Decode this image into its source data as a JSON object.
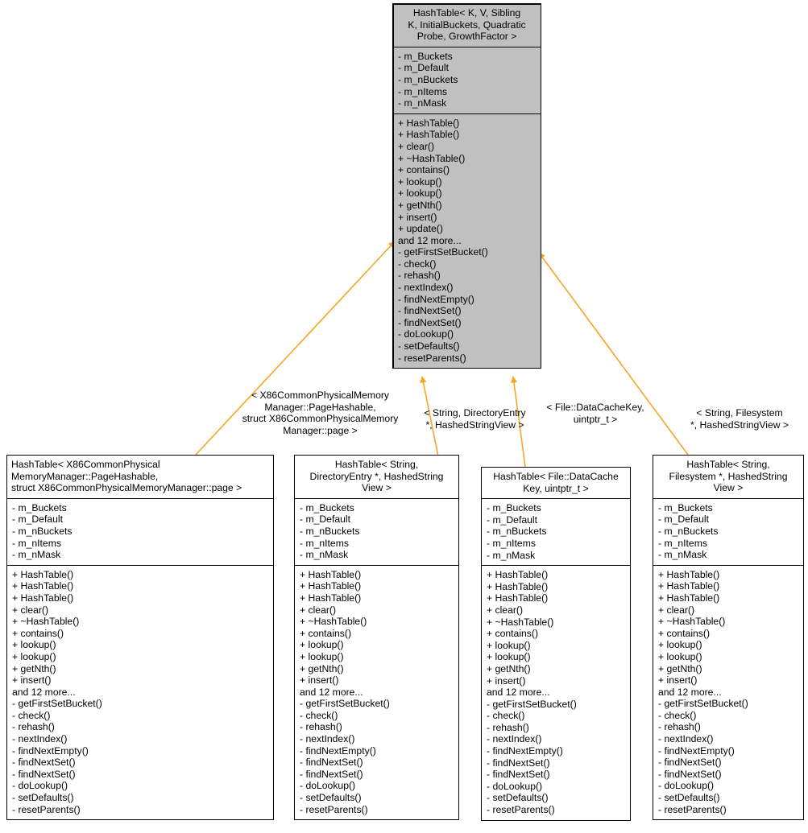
{
  "diagram": {
    "type": "uml-class-inheritance",
    "title": "HashTable template inheritance diagram",
    "colors": {
      "root_fill": "#c0c0c0",
      "child_fill": "#ffffff",
      "border": "#000000",
      "edge": "#f5a623",
      "background": "#ffffff"
    }
  },
  "classes": {
    "root": {
      "name": "HashTable< K, V, Sibling\nK, InitialBuckets, Quadratic\nProbe, GrowthFactor >",
      "attributes": [
        "- m_Buckets",
        "- m_Default",
        "- m_nBuckets",
        "- m_nItems",
        "- m_nMask"
      ],
      "methods": [
        "+ HashTable()",
        "+ HashTable()",
        "+ clear()",
        "+ ~HashTable()",
        "+ contains()",
        "+ lookup()",
        "+ lookup()",
        "+ getNth()",
        "+ insert()",
        "+ update()",
        "and 12 more...",
        "- getFirstSetBucket()",
        "- check()",
        "- rehash()",
        "- nextIndex()",
        "- findNextEmpty()",
        "- findNextSet()",
        "- findNextSet()",
        "- doLookup()",
        "- setDefaults()",
        "- resetParents()"
      ]
    },
    "child1": {
      "name": "HashTable< X86CommonPhysical\nMemoryManager::PageHashable,\n struct X86CommonPhysicalMemoryManager::page >",
      "attributes": [
        "- m_Buckets",
        "- m_Default",
        "- m_nBuckets",
        "- m_nItems",
        "- m_nMask"
      ],
      "methods": [
        "+ HashTable()",
        "+ HashTable()",
        "+ HashTable()",
        "+ clear()",
        "+ ~HashTable()",
        "+ contains()",
        "+ lookup()",
        "+ lookup()",
        "+ getNth()",
        "+ insert()",
        "and 12 more...",
        "- getFirstSetBucket()",
        "- check()",
        "- rehash()",
        "- nextIndex()",
        "- findNextEmpty()",
        "- findNextSet()",
        "- findNextSet()",
        "- doLookup()",
        "- setDefaults()",
        "- resetParents()"
      ]
    },
    "child2": {
      "name": "HashTable< String,\n DirectoryEntry *, HashedString\nView >",
      "attributes": [
        "- m_Buckets",
        "- m_Default",
        "- m_nBuckets",
        "- m_nItems",
        "- m_nMask"
      ],
      "methods": [
        "+ HashTable()",
        "+ HashTable()",
        "+ HashTable()",
        "+ clear()",
        "+ ~HashTable()",
        "+ contains()",
        "+ lookup()",
        "+ lookup()",
        "+ getNth()",
        "+ insert()",
        "and 12 more...",
        "- getFirstSetBucket()",
        "- check()",
        "- rehash()",
        "- nextIndex()",
        "- findNextEmpty()",
        "- findNextSet()",
        "- findNextSet()",
        "- doLookup()",
        "- setDefaults()",
        "- resetParents()"
      ]
    },
    "child3": {
      "name": "HashTable< File::DataCache\nKey, uintptr_t >",
      "attributes": [
        "- m_Buckets",
        "- m_Default",
        "- m_nBuckets",
        "- m_nItems",
        "- m_nMask"
      ],
      "methods": [
        "+ HashTable()",
        "+ HashTable()",
        "+ HashTable()",
        "+ clear()",
        "+ ~HashTable()",
        "+ contains()",
        "+ lookup()",
        "+ lookup()",
        "+ getNth()",
        "+ insert()",
        "and 12 more...",
        "- getFirstSetBucket()",
        "- check()",
        "- rehash()",
        "- nextIndex()",
        "- findNextEmpty()",
        "- findNextSet()",
        "- findNextSet()",
        "- doLookup()",
        "- setDefaults()",
        "- resetParents()"
      ]
    },
    "child4": {
      "name": "HashTable< String,\n Filesystem *, HashedString\nView >",
      "attributes": [
        "- m_Buckets",
        "- m_Default",
        "- m_nBuckets",
        "- m_nItems",
        "- m_nMask"
      ],
      "methods": [
        "+ HashTable()",
        "+ HashTable()",
        "+ HashTable()",
        "+ clear()",
        "+ ~HashTable()",
        "+ contains()",
        "+ lookup()",
        "+ lookup()",
        "+ getNth()",
        "+ insert()",
        "and 12 more...",
        "- getFirstSetBucket()",
        "- check()",
        "- rehash()",
        "- nextIndex()",
        "- findNextEmpty()",
        "- findNextSet()",
        "- findNextSet()",
        "- doLookup()",
        "- setDefaults()",
        "- resetParents()"
      ]
    }
  },
  "edges": [
    {
      "from": "child1",
      "to": "root",
      "label": "< X86CommonPhysicalMemory\nManager::PageHashable,\n struct X86CommonPhysicalMemory\nManager::page >"
    },
    {
      "from": "child2",
      "to": "root",
      "label": "< String, DirectoryEntry\n*, HashedStringView >"
    },
    {
      "from": "child3",
      "to": "root",
      "label": "< File::DataCacheKey,\nuintptr_t >"
    },
    {
      "from": "child4",
      "to": "root",
      "label": "< String, Filesystem\n*, HashedStringView >"
    }
  ]
}
